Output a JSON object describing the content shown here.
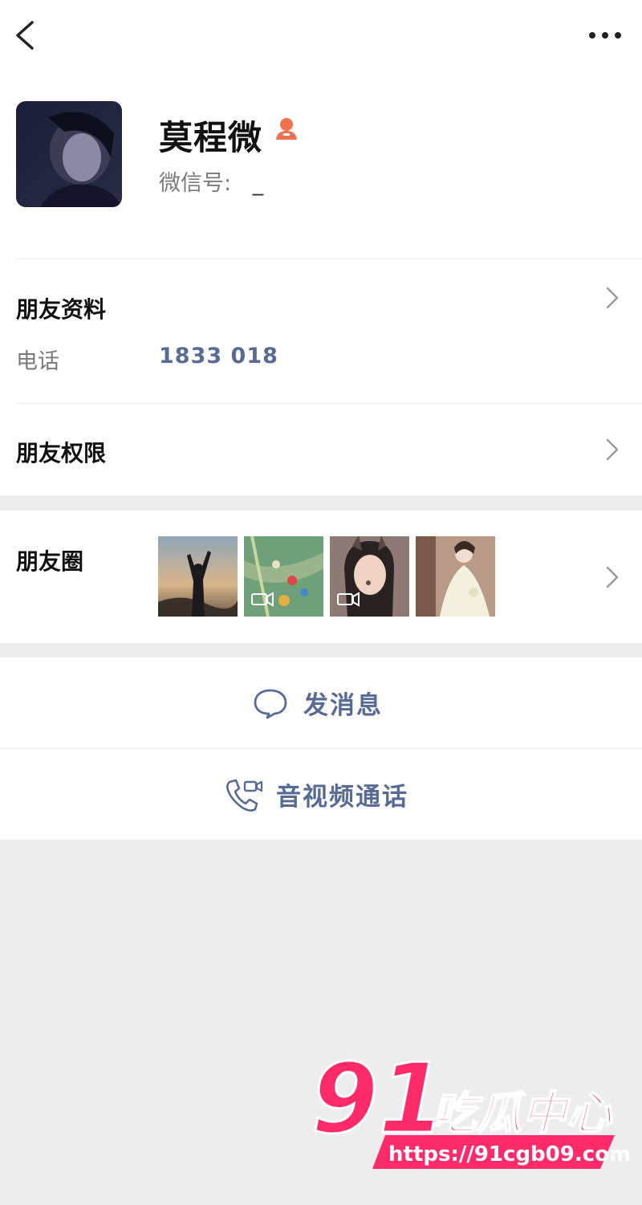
{
  "header": {
    "back_icon": "chevron-left-icon",
    "more_icon": "more-dots-icon"
  },
  "profile": {
    "name": "莫程微",
    "wechat_id_label": "微信号:",
    "wechat_id_value": "_",
    "badge_icon": "person-icon",
    "badge_color": "#f07050"
  },
  "friend_info": {
    "title": "朋友资料",
    "phone_label": "电话",
    "phone_value": "1833  018"
  },
  "friend_permissions": {
    "title": "朋友权限"
  },
  "moments": {
    "title": "朋友圈",
    "thumbnails": [
      {
        "subject": "silhouette-sunset",
        "video": false
      },
      {
        "subject": "game-screenshot",
        "video": true
      },
      {
        "subject": "girl-selfie",
        "video": true
      },
      {
        "subject": "girl-white-dress",
        "video": false
      }
    ]
  },
  "actions": {
    "message_label": "发消息",
    "message_icon": "chat-bubble-icon",
    "call_label": "音视频通话",
    "call_icon": "phone-video-icon",
    "accent_color": "#576b95"
  },
  "watermark": {
    "number": "91",
    "text": "吃瓜中心",
    "url": "https://91cgb09.com",
    "color": "#ff2a6a"
  }
}
